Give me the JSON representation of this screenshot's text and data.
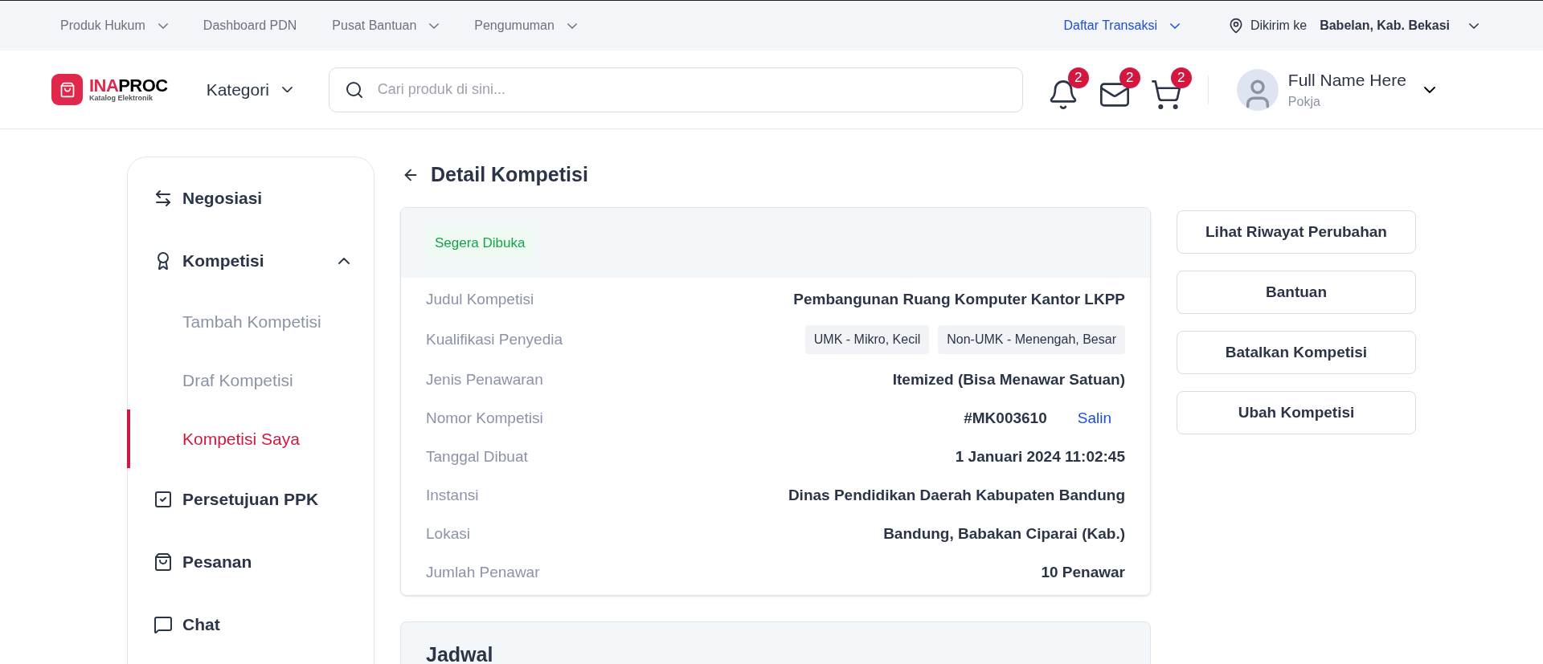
{
  "top_nav": {
    "left": [
      {
        "label": "Produk Hukum",
        "kind": "dropdown"
      },
      {
        "label": "Dashboard PDN",
        "kind": "link"
      },
      {
        "label": "Pusat Bantuan",
        "kind": "dropdown"
      },
      {
        "label": "Pengumuman",
        "kind": "dropdown"
      }
    ],
    "transactions": {
      "label": "Daftar Transaksi",
      "selected": true
    },
    "delivery": {
      "label": "Dikirim ke",
      "location": "Babelan, Kab. Bekasi"
    }
  },
  "header": {
    "logo": {
      "name_accent": "INA",
      "name_rest": "PROC",
      "subtitle": "Katalog Elektronik"
    },
    "category": "Kategori",
    "search": {
      "placeholder": "Cari produk di sini..."
    },
    "icons": [
      {
        "kind": "bell",
        "count": "2"
      },
      {
        "kind": "mail",
        "count": "2"
      },
      {
        "kind": "cart",
        "count": "2"
      }
    ],
    "user": {
      "name": "Full Name Here",
      "role": "Pokja"
    }
  },
  "sidebar": {
    "items": [
      {
        "label": "Negosiasi",
        "selected": false
      },
      {
        "label": "Kompetisi",
        "expanded": true,
        "selected": false,
        "children": [
          {
            "label": "Tambah Kompetisi",
            "selected": false
          },
          {
            "label": "Draf Kompetisi",
            "selected": false
          },
          {
            "label": "Kompetisi Saya",
            "selected": true
          }
        ]
      },
      {
        "label": "Persetujuan PPK",
        "selected": false
      },
      {
        "label": "Pesanan",
        "selected": false
      },
      {
        "label": "Chat",
        "selected": false
      }
    ]
  },
  "page_title": "Detail Kompetisi",
  "detail": {
    "status": {
      "label": "Segera Dibuka",
      "color": "#16a34a"
    },
    "rows": [
      {
        "label": "Judul Kompetisi",
        "kind": "text",
        "value": "Pembangunan Ruang Komputer Kantor LKPP"
      },
      {
        "label": "Kualifikasi Penyedia",
        "kind": "tags",
        "tags": [
          "UMK - Mikro, Kecil",
          "Non-UMK - Menengah, Besar"
        ]
      },
      {
        "label": "Jenis Penawaran",
        "kind": "text",
        "value": "Itemized (Bisa Menawar Satuan)"
      },
      {
        "label": "Nomor Kompetisi",
        "kind": "copy",
        "value": "#MK003610",
        "action": "Salin"
      },
      {
        "label": "Tanggal Dibuat",
        "kind": "text",
        "value": "1 Januari 2024 11:02:45"
      },
      {
        "label": "Instansi",
        "kind": "text",
        "value": "Dinas Pendidikan Daerah Kabupaten Bandung"
      },
      {
        "label": "Lokasi",
        "kind": "text",
        "value": "Bandung, Babakan Ciparai (Kab.)"
      },
      {
        "label": "Jumlah Penawar",
        "kind": "text",
        "value": "10 Penawar"
      }
    ]
  },
  "schedule": {
    "title": "Jadwal"
  },
  "actions": [
    "Lihat Riwayat Perubahan",
    "Bantuan",
    "Batalkan Kompetisi",
    "Ubah Kompetisi"
  ]
}
